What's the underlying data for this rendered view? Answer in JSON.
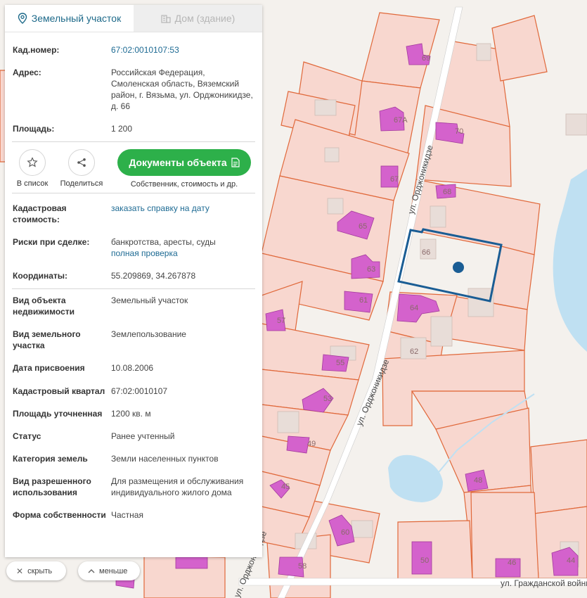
{
  "tabs": [
    {
      "label": "Земельный участок",
      "icon": "map-pin-icon",
      "active": true
    },
    {
      "label": "Дом (здание)",
      "icon": "building-icon",
      "active": false
    }
  ],
  "info_top": [
    {
      "label": "Кад.номер:",
      "value": "67:02:0010107:53",
      "is_link": true
    },
    {
      "label": "Адрес:",
      "value": "Российская Федерация, Смоленская область, Вяземский район, г. Вязьма, ул. Орджоникидзе, д. 66",
      "is_link": false
    },
    {
      "label": "Площадь:",
      "value": "1 200",
      "is_link": false
    }
  ],
  "actions": {
    "favorite_label": "В список",
    "share_label": "Поделиться",
    "documents_label": "Документы объекта",
    "documents_sub": "Собственник, стоимость и др."
  },
  "info_mid": {
    "cost_label": "Кадастровая стоимость:",
    "cost_link": "заказать справку на дату",
    "risks_label": "Риски при сделке:",
    "risks_value": "банкротства, аресты, суды",
    "risks_link": "полная проверка",
    "coords_label": "Координаты:",
    "coords_value": "55.209869, 34.267878"
  },
  "details": [
    {
      "label": "Вид объекта недвижимости",
      "value": "Земельный участок"
    },
    {
      "label": "Вид земельного участка",
      "value": "Землепользование"
    },
    {
      "label": "Дата присвоения",
      "value": "10.08.2006"
    },
    {
      "label": "Кадастровый квартал",
      "value": "67:02:0010107"
    },
    {
      "label": "Площадь уточненная",
      "value": "1200 кв. м"
    },
    {
      "label": "Статус",
      "value": "Ранее учтенный"
    },
    {
      "label": "Категория земель",
      "value": "Земли населенных пунктов"
    },
    {
      "label": "Вид разрешенного использования",
      "value": "Для размещения и обслуживания индивидуального жилого дома"
    },
    {
      "label": "Форма собственности",
      "value": "Частная"
    }
  ],
  "bottom_buttons": {
    "hide_label": "скрыть",
    "less_label": "меньше"
  },
  "map": {
    "streets": [
      "ул. Орджоникидзе",
      "ул. Орджоникидзе",
      "ул. Орджоникидзе",
      "ул. Гражданской войны"
    ],
    "lot_numbers": [
      "69",
      "67А",
      "70",
      "67",
      "68",
      "65",
      "66",
      "63",
      "61",
      "64",
      "57",
      "62",
      "55",
      "53",
      "49",
      "45",
      "48",
      "60",
      "58",
      "50",
      "46",
      "44"
    ],
    "colors": {
      "lot_fill": "#f8d7cf",
      "lot_border": "#e0683a",
      "house": "#d462cc",
      "selected": "#1a5d94",
      "water": "#bfe0f2",
      "road": "#ffffff"
    }
  }
}
